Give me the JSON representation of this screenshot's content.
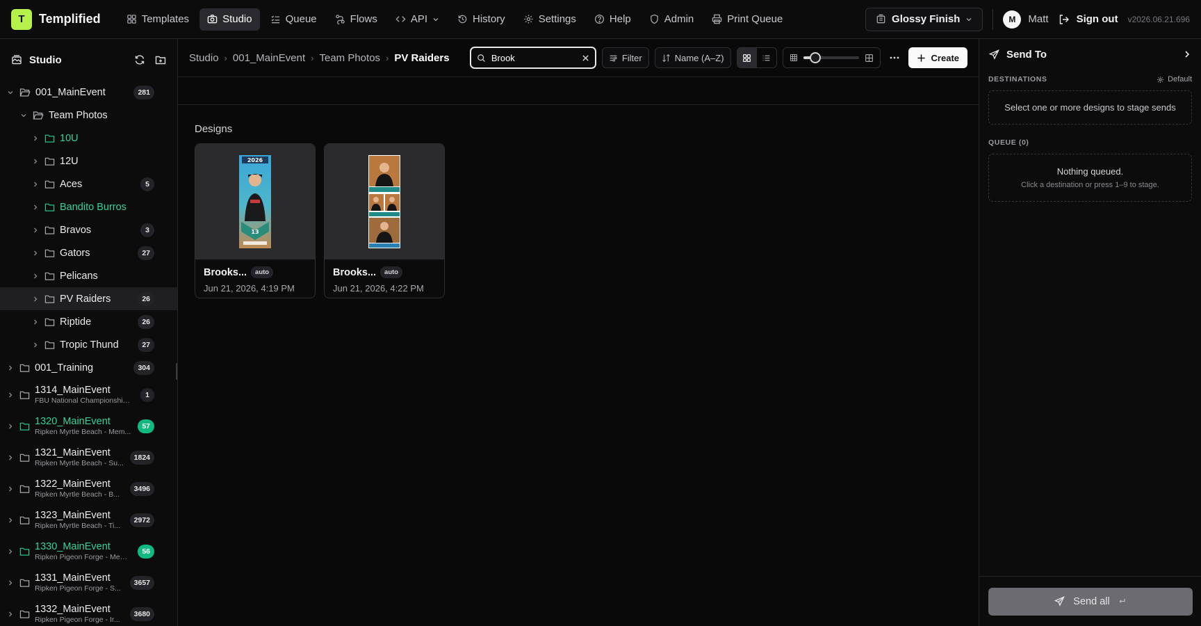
{
  "app": {
    "logo_letter": "T",
    "name": "Templified"
  },
  "nav": [
    {
      "label": "Templates",
      "icon": "grid-icon"
    },
    {
      "label": "Studio",
      "icon": "camera-icon",
      "active": true
    },
    {
      "label": "Queue",
      "icon": "list-icon"
    },
    {
      "label": "Flows",
      "icon": "flow-icon"
    },
    {
      "label": "API",
      "icon": "code-icon"
    },
    {
      "label": "History",
      "icon": "history-icon"
    },
    {
      "label": "Settings",
      "icon": "gear-icon"
    },
    {
      "label": "Help",
      "icon": "help-icon"
    },
    {
      "label": "Admin",
      "icon": "shield-icon"
    },
    {
      "label": "Print Queue",
      "icon": "printer-icon"
    }
  ],
  "top_right": {
    "finish_label": "Glossy Finish",
    "avatar_letter": "M",
    "user_name": "Matt",
    "signout_label": "Sign out",
    "version": "v2026.06.21.696"
  },
  "sidebar": {
    "title": "Studio",
    "tree": [
      {
        "label": "001_MainEvent",
        "count": "281",
        "level": 0,
        "expanded": true
      },
      {
        "label": "Team Photos",
        "count": "",
        "level": 1,
        "expanded": true
      },
      {
        "label": "10U",
        "count": "",
        "level": 2,
        "green": true
      },
      {
        "label": "12U",
        "count": "",
        "level": 2
      },
      {
        "label": "Aces",
        "count": "5",
        "level": 2
      },
      {
        "label": "Bandito Burros",
        "count": "",
        "level": 2,
        "green": true
      },
      {
        "label": "Bravos",
        "count": "3",
        "level": 2
      },
      {
        "label": "Gators",
        "count": "27",
        "level": 2
      },
      {
        "label": "Pelicans",
        "count": "",
        "level": 2
      },
      {
        "label": "PV Raiders",
        "count": "26",
        "level": 2,
        "selected": true
      },
      {
        "label": "Riptide",
        "count": "26",
        "level": 2
      },
      {
        "label": "Tropic Thund",
        "count": "27",
        "level": 2
      },
      {
        "label": "001_Training",
        "count": "304",
        "level": 0
      },
      {
        "label": "1314_MainEvent",
        "sub": "FBU National Championships ...",
        "count": "1",
        "level": 0
      },
      {
        "label": "1320_MainEvent",
        "sub": "Ripken Myrtle Beach - Mem...",
        "count": "57",
        "level": 0,
        "green": true
      },
      {
        "label": "1321_MainEvent",
        "sub": "Ripken Myrtle Beach - Su...",
        "count": "1824",
        "level": 0
      },
      {
        "label": "1322_MainEvent",
        "sub": "Ripken Myrtle Beach - B...",
        "count": "3496",
        "level": 0
      },
      {
        "label": "1323_MainEvent",
        "sub": "Ripken Myrtle Beach - Ti...",
        "count": "2972",
        "level": 0
      },
      {
        "label": "1330_MainEvent",
        "sub": "Ripken Pigeon Forge - Mem...",
        "count": "56",
        "level": 0,
        "green": true
      },
      {
        "label": "1331_MainEvent",
        "sub": "Ripken Pigeon Forge - S...",
        "count": "3657",
        "level": 0
      },
      {
        "label": "1332_MainEvent",
        "sub": "Ripken Pigeon Forge - Ir...",
        "count": "3680",
        "level": 0
      }
    ]
  },
  "toolbar": {
    "breadcrumbs": [
      "Studio",
      "001_MainEvent",
      "Team Photos",
      "PV Raiders"
    ],
    "search_value": "Brook",
    "filter_label": "Filter",
    "sort_label": "Name (A–Z)",
    "zoom_level": 0.22,
    "create_label": "Create"
  },
  "content": {
    "section_title": "Designs",
    "cards": [
      {
        "title": "Brooks...",
        "badge": "auto",
        "date": "Jun 21, 2026, 4:19 PM"
      },
      {
        "title": "Brooks...",
        "badge": "auto",
        "date": "Jun 21, 2026, 4:22 PM"
      }
    ]
  },
  "right_panel": {
    "title": "Send To",
    "destinations_label": "DESTINATIONS",
    "default_label": "Default",
    "destinations_empty": "Select one or more designs to stage sends",
    "queue_label": "QUEUE (0)",
    "queue_empty_main": "Nothing queued.",
    "queue_empty_sub": "Click a destination or press 1–9 to stage.",
    "send_all_label": "Send all"
  },
  "colors": {
    "accent_lime": "#b6f04b",
    "green": "#10b981",
    "background": "#0a0a0b"
  }
}
